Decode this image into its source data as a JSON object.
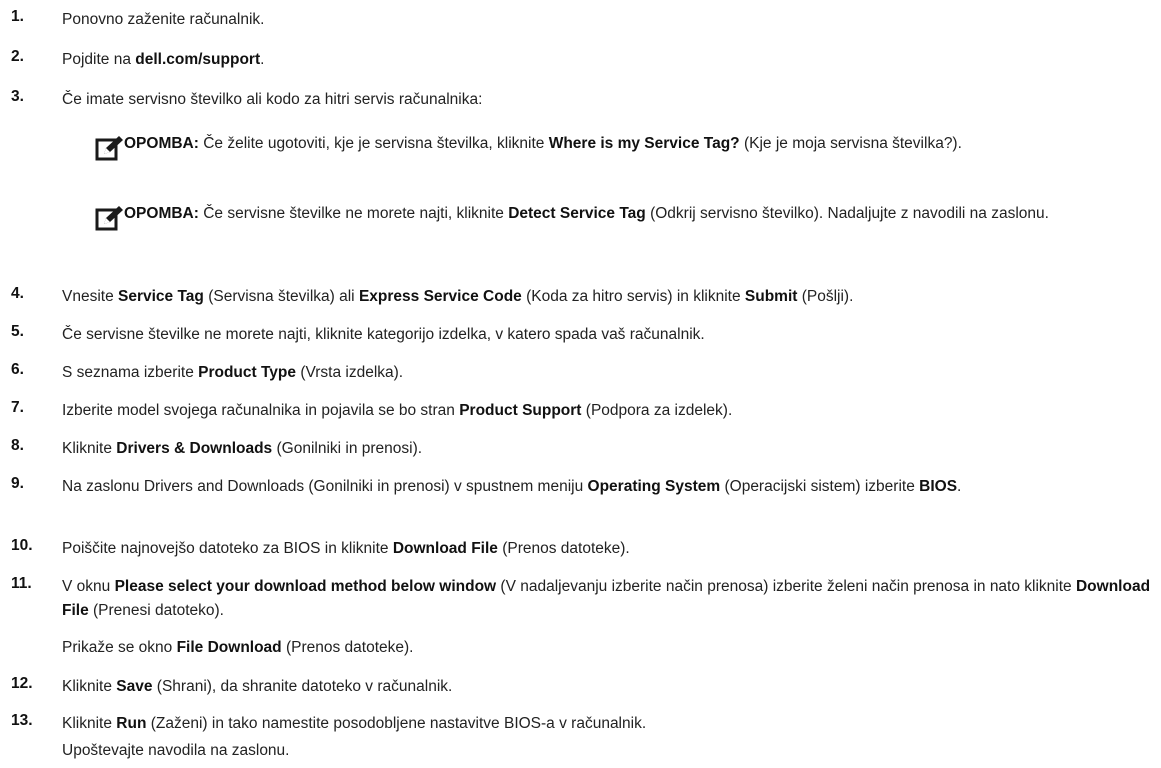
{
  "steps": [
    {
      "num": "1.",
      "parts": [
        {
          "t": "Ponovno zaženite računalnik."
        }
      ]
    },
    {
      "num": "2.",
      "parts": [
        {
          "t": "Pojdite na "
        },
        {
          "t": "dell.com/support",
          "b": true
        },
        {
          "t": "."
        }
      ]
    },
    {
      "num": "3.",
      "parts": [
        {
          "t": "Če imate servisno številko ali kodo za hitri servis računalnika:"
        }
      ]
    },
    {
      "num": "4.",
      "parts": [
        {
          "t": "Vnesite "
        },
        {
          "t": "Service Tag",
          "b": true
        },
        {
          "t": " (Servisna številka) ali "
        },
        {
          "t": "Express Service Code",
          "b": true
        },
        {
          "t": " (Koda za hitro servis) in kliknite "
        },
        {
          "t": "Submit",
          "b": true
        },
        {
          "t": " (Pošlji)."
        }
      ]
    },
    {
      "num": "5.",
      "parts": [
        {
          "t": "Če servisne številke ne morete najti, kliknite kategorijo izdelka, v katero spada vaš računalnik."
        }
      ]
    },
    {
      "num": "6.",
      "parts": [
        {
          "t": "S seznama izberite "
        },
        {
          "t": "Product Type",
          "b": true
        },
        {
          "t": " (Vrsta izdelka)."
        }
      ]
    },
    {
      "num": "7.",
      "parts": [
        {
          "t": "Izberite model svojega računalnika in pojavila se bo stran "
        },
        {
          "t": "Product Support",
          "b": true
        },
        {
          "t": " (Podpora za izdelek)."
        }
      ]
    },
    {
      "num": "8.",
      "parts": [
        {
          "t": "Kliknite "
        },
        {
          "t": "Drivers & Downloads",
          "b": true
        },
        {
          "t": " (Gonilniki in prenosi)."
        }
      ]
    },
    {
      "num": "9.",
      "parts": [
        {
          "t": "Na zaslonu Drivers and Downloads (Gonilniki in prenosi) v spustnem meniju "
        },
        {
          "t": "Operating System",
          "b": true
        },
        {
          "t": " (Operacijski sistem) izberite "
        },
        {
          "t": "BIOS",
          "b": true
        },
        {
          "t": "."
        }
      ]
    },
    {
      "num": "10.",
      "parts": [
        {
          "t": "Poiščite najnovejšo datoteko za BIOS in kliknite "
        },
        {
          "t": "Download File",
          "b": true
        },
        {
          "t": " (Prenos datoteke)."
        }
      ]
    },
    {
      "num": "11.",
      "parts": [
        {
          "t": "V oknu "
        },
        {
          "t": "Please select your download method below window",
          "b": true
        },
        {
          "t": " (V nadaljevanju izberite način prenosa) izberite želeni način prenosa in nato kliknite "
        },
        {
          "t": "Download File",
          "b": true
        },
        {
          "t": " (Prenesi datoteko)."
        }
      ]
    },
    {
      "num": "12.",
      "parts": [
        {
          "t": "Kliknite "
        },
        {
          "t": "Save",
          "b": true
        },
        {
          "t": " (Shrani), da shranite datoteko v računalnik."
        }
      ]
    },
    {
      "num": "13.",
      "parts": [
        {
          "t": "Kliknite "
        },
        {
          "t": "Run",
          "b": true
        },
        {
          "t": " (Zaženi) in tako namestite posodobljene nastavitve BIOS-a v računalnik."
        }
      ]
    }
  ],
  "notes": [
    {
      "label": "OPOMBA:",
      "icon": "note-pencil-icon",
      "parts": [
        {
          "t": " Če želite ugotoviti, kje je servisna številka, kliknite "
        },
        {
          "t": "Where is my Service Tag?",
          "b": true
        },
        {
          "t": " (Kje je moja servisna številka?)."
        }
      ]
    },
    {
      "label": "OPOMBA:",
      "icon": "note-pencil-icon",
      "parts": [
        {
          "t": " Če servisne številke ne morete najti, kliknite "
        },
        {
          "t": "Detect Service Tag",
          "b": true
        },
        {
          "t": " (Odkrij servisno številko). Nadaljujte z navodili na zaslonu."
        }
      ]
    }
  ],
  "followups": {
    "after_11": [
      {
        "t": "Prikaže se okno "
      },
      {
        "t": "File Download",
        "b": true
      },
      {
        "t": " (Prenos datoteke)."
      }
    ],
    "after_13": [
      {
        "t": "Upoštevajte navodila na zaslonu."
      }
    ]
  },
  "colors": {
    "text": "#222222",
    "bold": "#111111",
    "icon_bg": "#1a1a1a"
  }
}
